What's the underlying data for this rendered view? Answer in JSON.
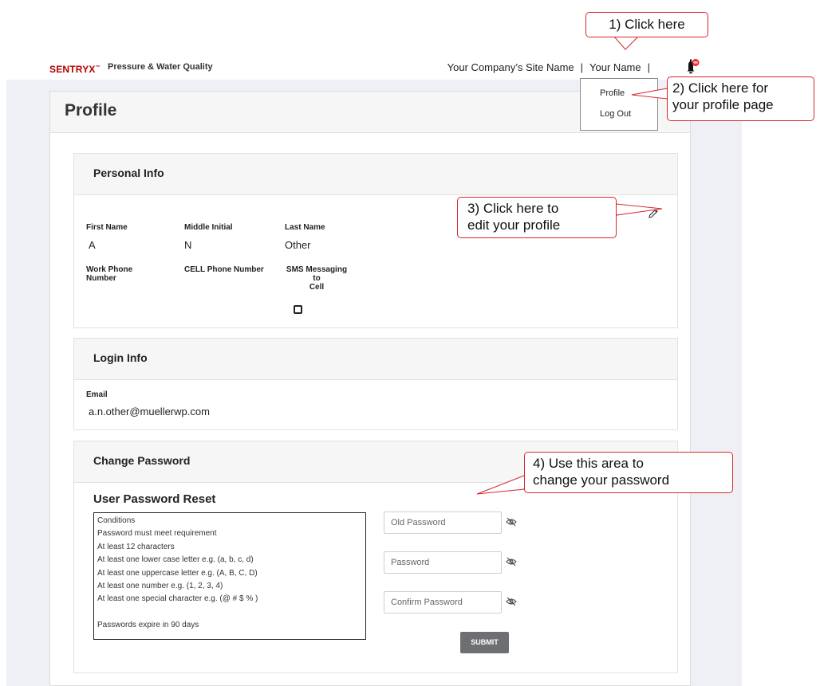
{
  "header": {
    "brand": "SENTRYX",
    "brand_mark": "™",
    "tagline": "Pressure & Water Quality",
    "site_name": "Your Company’s Site Name",
    "separator": "|",
    "user_name": "Your Name",
    "notification_count": "99"
  },
  "user_menu": {
    "items": [
      "Profile",
      "Log Out"
    ]
  },
  "page": {
    "title": "Profile"
  },
  "personal_info": {
    "title": "Personal Info",
    "first_name_label": "First Name",
    "first_name_value": "A",
    "middle_initial_label": "Middle Initial",
    "middle_initial_value": "N",
    "last_name_label": "Last Name",
    "last_name_value": "Other",
    "work_phone_label_1": "Work Phone",
    "work_phone_label_2": "Number",
    "cell_phone_label": "CELL Phone Number",
    "sms_label_1": "SMS Messaging",
    "sms_label_2": "to",
    "sms_label_3": "Cell",
    "edit_icon": "pencil-icon"
  },
  "login_info": {
    "title": "Login Info",
    "email_label": "Email",
    "email_value": "a.n.other@muellerwp.com"
  },
  "change_password": {
    "title": "Change Password",
    "reset_title": "User Password Reset",
    "conditions": [
      "Conditions",
      "Password must meet requirement",
      "At least 12 characters",
      "At least one lower case letter e.g. (a, b, c, d)",
      "At least one uppercase letter e.g. (A, B, C, D)",
      "At least one number e.g. (1, 2, 3, 4)",
      "At least one special character e.g. (@ # $ % )",
      "",
      "Passwords expire in 90 days"
    ],
    "old_password_placeholder": "Old Password",
    "password_placeholder": "Password",
    "confirm_password_placeholder": "Confirm Password",
    "submit_label": "SUBMIT",
    "visibility_icon": "eye-off-icon"
  },
  "callouts": {
    "c1": "1) Click here",
    "c2_line1": "2) Click here for",
    "c2_line2": "your profile page",
    "c3_line1": "3) Click here to",
    "c3_line2": "edit your profile",
    "c4_line1": "4) Use this area to",
    "c4_line2": "change your password"
  },
  "colors": {
    "brand": "#b30000",
    "callout_border": "#d9262e",
    "submit_bg": "#6d6f73",
    "page_bg": "#eef0f5"
  }
}
